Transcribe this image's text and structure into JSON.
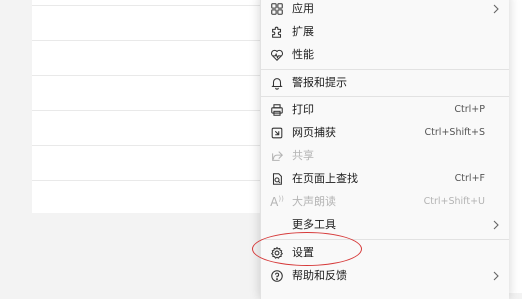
{
  "menu": {
    "items": [
      {
        "name": "apps",
        "label": "应用",
        "shortcut": "",
        "submenu": true,
        "disabled": false,
        "icon": "apps-grid-icon"
      },
      {
        "name": "extensions",
        "label": "扩展",
        "shortcut": "",
        "submenu": false,
        "disabled": false,
        "icon": "puzzle-icon"
      },
      {
        "name": "performance",
        "label": "性能",
        "shortcut": "",
        "submenu": false,
        "disabled": false,
        "icon": "heart-pulse-icon"
      },
      {
        "name": "alerts",
        "label": "警报和提示",
        "shortcut": "",
        "submenu": false,
        "disabled": false,
        "icon": "bell-icon"
      },
      {
        "name": "print",
        "label": "打印",
        "shortcut": "Ctrl+P",
        "submenu": false,
        "disabled": false,
        "icon": "printer-icon"
      },
      {
        "name": "web-capture",
        "label": "网页捕获",
        "shortcut": "Ctrl+Shift+S",
        "submenu": false,
        "disabled": false,
        "icon": "web-capture-icon"
      },
      {
        "name": "share",
        "label": "共享",
        "shortcut": "",
        "submenu": false,
        "disabled": true,
        "icon": "share-icon"
      },
      {
        "name": "find-on-page",
        "label": "在页面上查找",
        "shortcut": "Ctrl+F",
        "submenu": false,
        "disabled": false,
        "icon": "find-icon"
      },
      {
        "name": "read-aloud",
        "label": "大声朗读",
        "shortcut": "Ctrl+Shift+U",
        "submenu": false,
        "disabled": true,
        "icon": "read-aloud-icon"
      },
      {
        "name": "more-tools",
        "label": "更多工具",
        "shortcut": "",
        "submenu": true,
        "disabled": false,
        "icon": ""
      },
      {
        "name": "settings",
        "label": "设置",
        "shortcut": "",
        "submenu": false,
        "disabled": false,
        "icon": "gear-icon"
      },
      {
        "name": "help-feedback",
        "label": "帮助和反馈",
        "shortcut": "",
        "submenu": true,
        "disabled": false,
        "icon": "help-icon"
      }
    ],
    "read_aloud_glyph": "A"
  },
  "colors": {
    "annotation_circle": "#d63a3a",
    "menu_background": "#f9f9f9",
    "disabled_text": "#b4b4b4"
  }
}
